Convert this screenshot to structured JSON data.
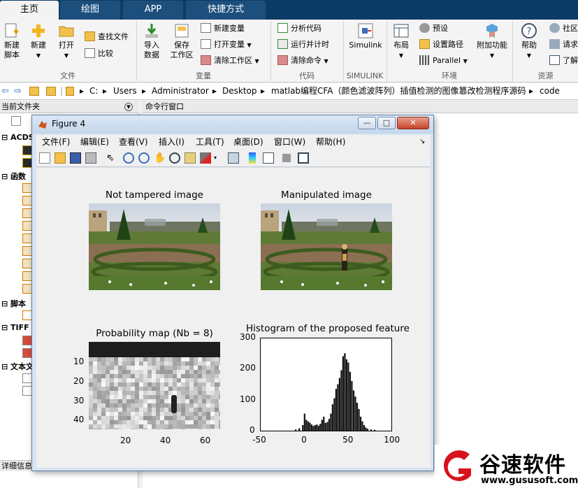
{
  "tabs": [
    {
      "label": "主页",
      "active": true
    },
    {
      "label": "绘图",
      "active": false
    },
    {
      "label": "APP",
      "active": false
    },
    {
      "label": "快捷方式",
      "active": false
    }
  ],
  "ribbon": {
    "new_script": {
      "line1": "新建",
      "line2": "脚本"
    },
    "new": "新建",
    "open": "打开",
    "find_files": "查找文件",
    "compare": "比较",
    "import": {
      "line1": "导入",
      "line2": "数据"
    },
    "save_ws": {
      "line1": "保存",
      "line2": "工作区"
    },
    "new_var": "新建变量",
    "open_var": "打开变量",
    "clear_ws": "清除工作区",
    "analyze_code": "分析代码",
    "run_time": "运行并计时",
    "clear_cmd": "清除命令",
    "simulink": "Simulink",
    "layout": "布局",
    "prefs": "预设",
    "set_path": "设置路径",
    "parallel": "Parallel",
    "addons": "附加功能",
    "help": "帮助",
    "community": "社区",
    "request": "请求支",
    "learn": "了解",
    "groups": {
      "file": "文件",
      "variable": "变量",
      "code": "代码",
      "simulink": "SIMULINK",
      "env": "环境",
      "resources": "资源"
    }
  },
  "address": {
    "segments": [
      "C:",
      "Users",
      "Administrator",
      "Desktop",
      "matlab编程CFA（颜色滤波阵列）插值检测的图像篡改检测程序源码",
      "code"
    ]
  },
  "panels": {
    "current_folder": "当前文件夹",
    "command_window": "命令行窗口",
    "details": "详细信息",
    "sections": [
      "ACDS",
      "函数",
      "脚本",
      "TIFF",
      "文本文"
    ]
  },
  "figure": {
    "title": "Figure 4",
    "minimize": "—",
    "maximize": "□",
    "close": "✕",
    "menu": [
      "文件(F)",
      "编辑(E)",
      "查看(V)",
      "插入(I)",
      "工具(T)",
      "桌面(D)",
      "窗口(W)",
      "帮助(H)"
    ],
    "toolbar_icons": [
      "new-figure-icon",
      "open-file-icon",
      "save-icon",
      "print-icon",
      "pointer-icon",
      "zoom-in-icon",
      "zoom-out-icon",
      "pan-icon",
      "rotate-icon",
      "data-cursor-icon",
      "brush-icon",
      "link-icon",
      "colorbar-icon",
      "legend-icon",
      "hide-tools-icon",
      "dock-icon"
    ],
    "subplots": {
      "original_title": "Not tampered image",
      "manipulated_title": "Manipulated image",
      "probmap_title": "Probability map (Nb = 8)",
      "hist_title": "Histogram of the proposed feature"
    }
  },
  "chart_data": [
    {
      "type": "heatmap",
      "title": "Probability map (Nb = 8)",
      "xticks": [
        20,
        40,
        60
      ],
      "yticks": [
        10,
        20,
        30,
        40
      ],
      "xlim": [
        1,
        66
      ],
      "ylim": [
        1,
        45
      ],
      "note_region": {
        "x": [
          40,
          42
        ],
        "y": [
          28,
          36
        ]
      }
    },
    {
      "type": "bar",
      "title": "Histogram of the proposed feature",
      "xlim": [
        -50,
        100
      ],
      "ylim": [
        0,
        300
      ],
      "xticks": [
        -50,
        0,
        50,
        100
      ],
      "yticks": [
        0,
        100,
        200,
        300
      ],
      "x": [
        -10,
        -6,
        -2,
        0,
        2,
        4,
        6,
        8,
        10,
        12,
        14,
        16,
        18,
        20,
        22,
        24,
        26,
        28,
        30,
        32,
        34,
        36,
        38,
        40,
        42,
        44,
        46,
        48,
        50,
        52,
        54,
        56,
        58,
        60,
        62,
        64,
        66,
        68,
        70,
        72,
        76,
        80
      ],
      "values": [
        4,
        8,
        18,
        55,
        35,
        30,
        26,
        20,
        15,
        18,
        20,
        16,
        22,
        35,
        45,
        25,
        28,
        38,
        55,
        85,
        105,
        135,
        150,
        170,
        195,
        240,
        250,
        230,
        220,
        190,
        160,
        130,
        110,
        90,
        70,
        45,
        30,
        18,
        10,
        6,
        4,
        3
      ]
    }
  ],
  "watermark": {
    "brand": "谷速软件",
    "url": "www.gususoft.com"
  },
  "colors": {
    "tabbar": "#0b3b66",
    "watermark_red": "#d7121d"
  }
}
